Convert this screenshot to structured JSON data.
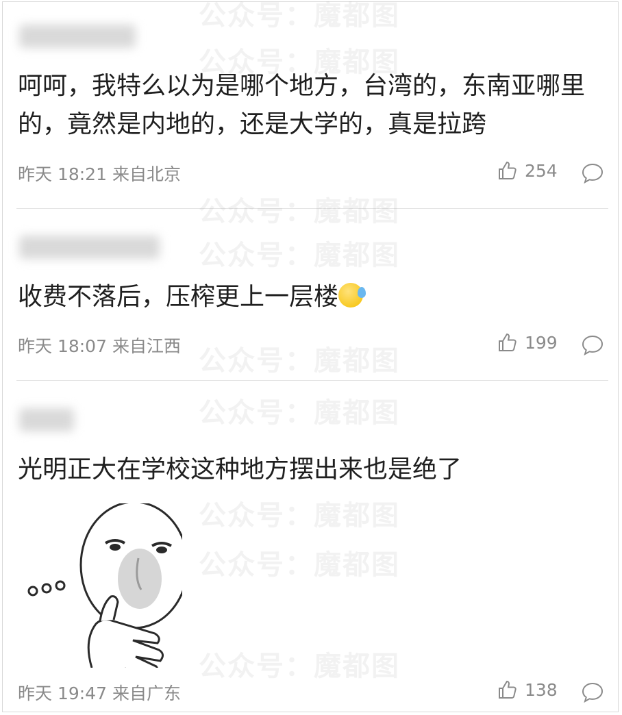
{
  "comments": [
    {
      "text": "呵呵，我特么以为是哪个地方，台湾的，东南亚哪里的，竟然是内地的，还是大学的，真是拉跨",
      "time": "昨天 18:21",
      "location": "来自北京",
      "likes": "254"
    },
    {
      "text": "收费不落后，压榨更上一层楼",
      "emoji": "sweat-smile-emoji",
      "time": "昨天 18:07",
      "location": "来自江西",
      "likes": "199"
    },
    {
      "text": "光明正大在学校这种地方摆出来也是绝了",
      "sticker": "thinking-meme-sticker",
      "time": "昨天 19:47",
      "location": "来自广东",
      "likes": "138"
    }
  ],
  "watermark": "公众号：魔都图",
  "colors": {
    "text": "#1f1f1f",
    "meta": "#8a8a8a",
    "divider": "#e3e3e3"
  }
}
